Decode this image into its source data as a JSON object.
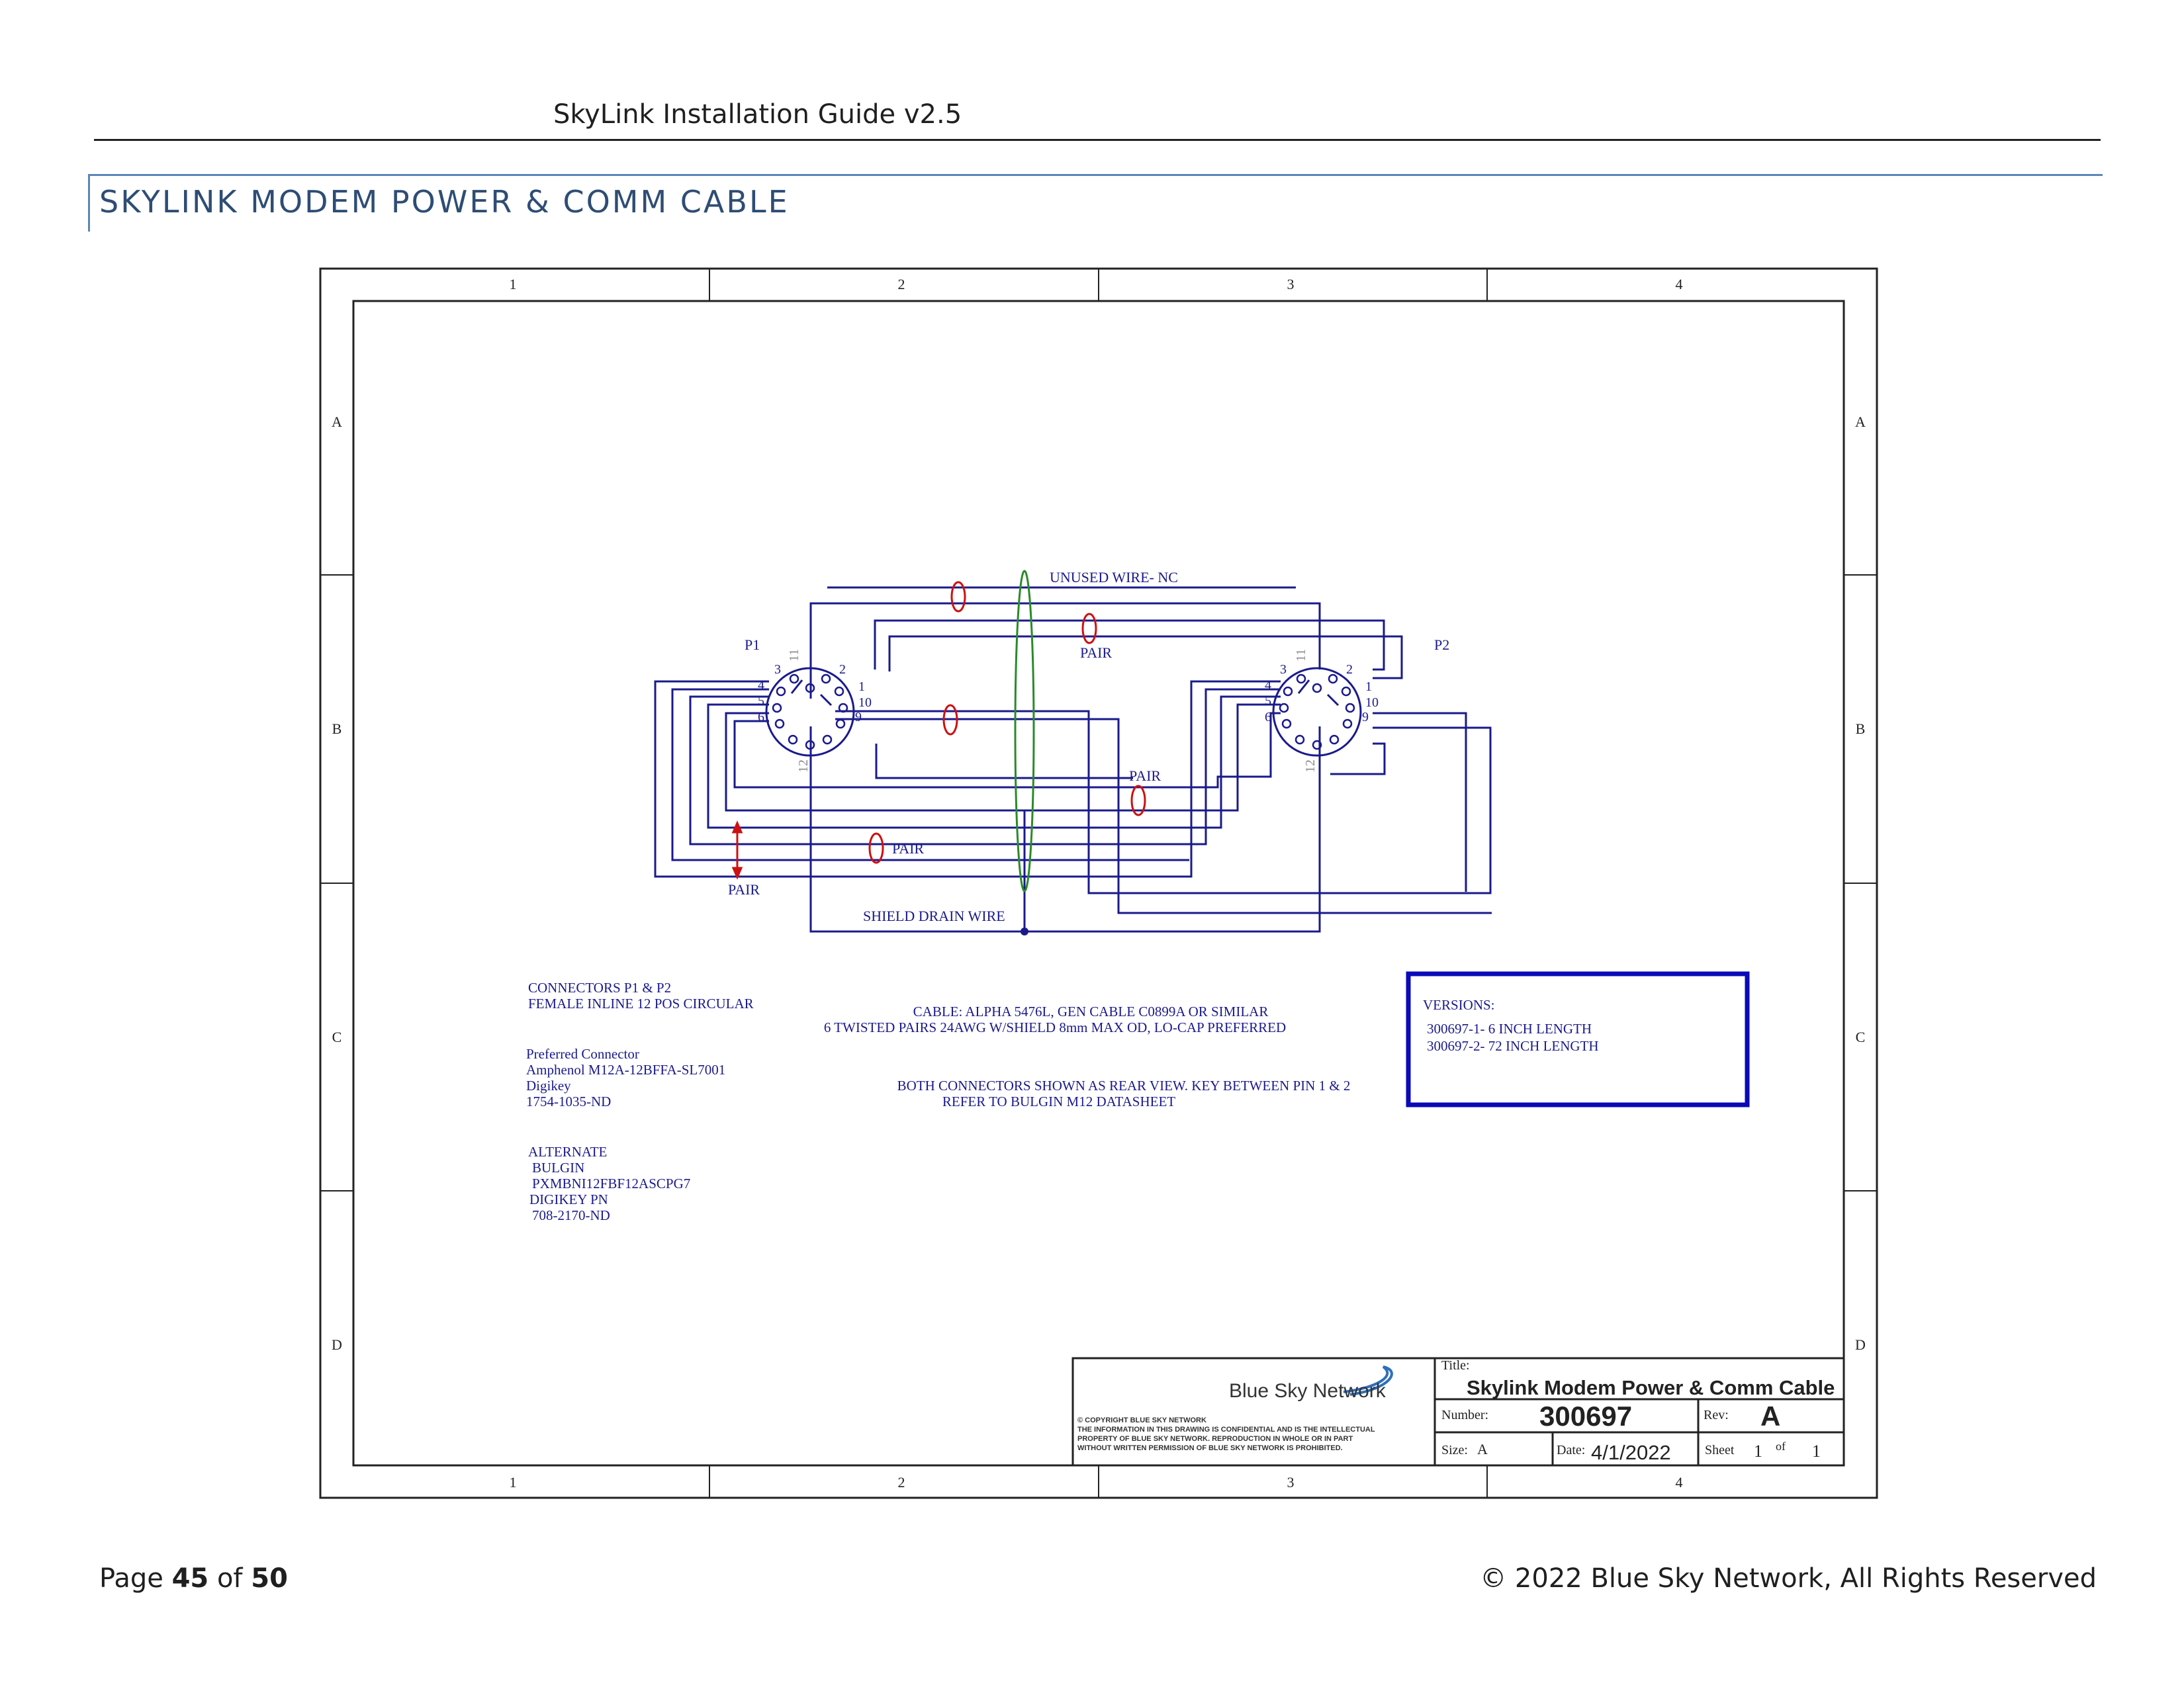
{
  "header": {
    "doc_title": "SkyLink Installation Guide v2.5"
  },
  "section": {
    "title": "SKYLINK MODEM POWER & COMM CABLE"
  },
  "drawing": {
    "zone_columns": [
      "1",
      "2",
      "3",
      "4"
    ],
    "zone_rows": [
      "A",
      "B",
      "C",
      "D"
    ],
    "labels": {
      "p1": "P1",
      "p2": "P2",
      "unused_wire": "UNUSED WIRE- NC",
      "pair": "PAIR",
      "shield_drain": "SHIELD DRAIN WIRE"
    },
    "pins": [
      "1",
      "2",
      "3",
      "4",
      "5",
      "6",
      "9",
      "10",
      "11",
      "12"
    ],
    "notes": {
      "connectors": [
        "CONNECTORS P1 & P2",
        "FEMALE INLINE 12 POS CIRCULAR"
      ],
      "preferred": [
        "Preferred Connector",
        "Amphenol M12A-12BFFA-SL7001",
        "Digikey",
        "1754-1035-ND"
      ],
      "alternate": [
        "ALTERNATE",
        "BULGIN",
        "PXMBNI12FBF12ASCPG7",
        "DIGIKEY PN",
        "708-2170-ND"
      ],
      "cable": [
        "CABLE: ALPHA 5476L, GEN CABLE C0899A OR SIMILAR",
        "6 TWISTED PAIRS 24AWG W/SHIELD 8mm MAX OD, LO-CAP PREFERRED"
      ],
      "connector_view": [
        "BOTH CONNECTORS SHOWN AS REAR VIEW. KEY BETWEEN PIN 1 & 2",
        "REFER TO BULGIN M12 DATASHEET"
      ],
      "versions": [
        "VERSIONS:",
        "300697-1-  6 INCH LENGTH",
        "300697-2-  72 INCH LENGTH"
      ]
    },
    "title_block": {
      "company": "Blue Sky Network",
      "copyright": [
        "© COPYRIGHT BLUE SKY NETWORK",
        "THE INFORMATION IN THIS DRAWING IS CONFIDENTIAL AND IS THE INTELLECTUAL",
        "PROPERTY OF BLUE SKY NETWORK. REPRODUCTION IN WHOLE OR IN PART",
        "WITHOUT WRITTEN PERMISSION OF BLUE SKY NETWORK IS PROHIBITED."
      ],
      "title_label": "Title:",
      "title": "Skylink Modem Power & Comm Cable",
      "number_label": "Number:",
      "number": "300697",
      "rev_label": "Rev:",
      "rev": "A",
      "size_label": "Size:",
      "size": "A",
      "date_label": "Date:",
      "date": "4/1/2022",
      "sheet_label": "Sheet",
      "sheet": "1",
      "of_label": "of",
      "sheets": "1"
    },
    "colors": {
      "wire": "#1a1a8c",
      "ring": "#cc1111",
      "shield": "#2a8a2a",
      "frame": "#222222"
    }
  },
  "footer": {
    "page_prefix": "Page",
    "page_number": "45",
    "page_of": "of",
    "page_total": "50",
    "copyright": "© 2022 Blue Sky Network, All Rights Reserved"
  }
}
